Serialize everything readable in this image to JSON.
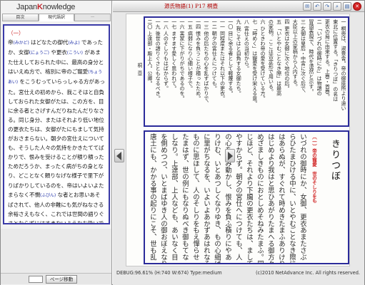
{
  "app": {
    "logo_prefix": "Japan",
    "logo_k": "K",
    "logo_suffix": "nowledge"
  },
  "tabs": [
    {
      "label": "目次"
    },
    {
      "label": "現代語訳"
    },
    {
      "label": "ー"
    }
  ],
  "translation": {
    "section_label": "（一）",
    "lines": [
      "帝 [みかど] はどなたの御代 [みよ] であったか、女御 [にょうご] や更衣 [こうい] があまた仕えしておられた中に、最高の身分とはいえぬ方で、格別に帝のご寵愛 [ちょうあい] をこうむっていらっしゃる方があった。宮仕えの初めから、我こそはと自負しておられた女御がたは、この方を、目に余る者とさげすんだりねたんだりなさる。同じ身分、またはそれより低い地位の更衣たちは、女御がたにもまして気持がおさまらない。朝夕の宮仕えについても、そうした人々の気持をかきたててばかりで、恨みを受けることが積り積ったためだろうか、まったく病がちの身となり、どことなく頼りなげな様子で里下がりばかりしているのを、帝はいよいよたまらなく不憫 [ふびん] な者とお思いあそばされて、他人の非難にも気がねなさる余裕さえもなく、これでは世間の語りぐさとならずにはすまないようなお扱いである。上達部 [かんだちめ] や殿上人 [てんじょうびと] なども、あいなくも目をそばめつつ、まったく正視にたえぬご寵愛ぶりである。唐土 [もろこし] でも、こうした事が起って、世の中も乱れ、不都合な"
    ]
  },
  "pager": {
    "button_label": "ページ移動"
  },
  "viewer": {
    "title": "源氏物語(1) P17 桐壺",
    "toolbar_icons": [
      "mail-icon",
      "back-icon",
      "forward-icon",
      "zoom-icon",
      "page-icon",
      "close-icon"
    ],
    "note_label": "桐壺",
    "chapter_title": "きりつぼ",
    "section_heading": "〔一〕帝の寵愛　世のそしりをも",
    "notes_columns": [
      "一 桐壺は、淑景舎。帝の御座所より遠い",
      "東北に位置する。「きりつぼ」の名は",
      "更衣の局に由来する。上巻・首巻。",
      "二 「いづれの御時にか」は物語の",
      "冒頭表現で、時代を漠然と示す。",
      "三 女御は皇后・中宮に次ぐ后で、",
      "大臣以上の家柄から入内する。",
      "四 更衣は女御に次ぐ地位の后。",
      "五 「いとやむごとなき際」は最高",
      "の家柄。ここは否定形で用いる。",
      "六 ひときわ帝の愛を受けている方。",
      "七 「時めく」は寵愛を受け栄える意。",
      "八 宮仕えの当初から。",
      "九 我こそはと自負する女御たち。",
      "一〇 目に余る者として軽蔑する。",
      "一一 同程度またはそれ以下の更衣。",
      "一二 朝夕の宮仕えにつけても。",
      "一三 他の后たちの心を乱すばかりで、",
      "一四 恨みを負うことが積ったため。",
      "一五 病弱になり心細い様子で。",
      "一六 実家に下がりがちであるのを。",
      "一七 ますます愛しく思われて。",
      "一八 人のそしりもはばからず。",
      "一九 後世の語りぐさともなるべき。",
      "二〇 上達部・殿上人。公卿。"
    ],
    "main_columns": [
      "いづれの御時にか、女御、更衣あまたさぶ",
      "らひたまひける中に、いとやむごとなき際に",
      "はあらぬが、すぐれて時めきたまふありけり。",
      "はじめより我はと思ひあがりたまへる御方々、",
      "めざましきものにおとしめそねみたまふ。同",
      "じほど、それより下臈の更衣たちは、まして",
      "やすからず。朝夕の宮仕へにつけても、人",
      "の心をのみ動かし、恨みを負ふ積りにやあ",
      "りけむ、いとあつしくなりゆき、もの心細げ",
      "に里がちなるを、いよいよあかずあはれなる",
      "ものに思ほして、人のそしりをもえ憚らせ",
      "たまはず、世の例にもなりぬべき御もてな",
      "しなり。上達部、上人なども、あいなく目",
      "を側めつつ、いとまばゆき人の御おぼえなり。",
      "唐土にも、かかる事の起りにこそ、世も乱"
    ]
  },
  "status": {
    "debug": "DEBUG:96.61% (H:740 W:674) Type:medium",
    "copyright": "(c)2010 NetAdvance Inc. All rights reserved."
  }
}
